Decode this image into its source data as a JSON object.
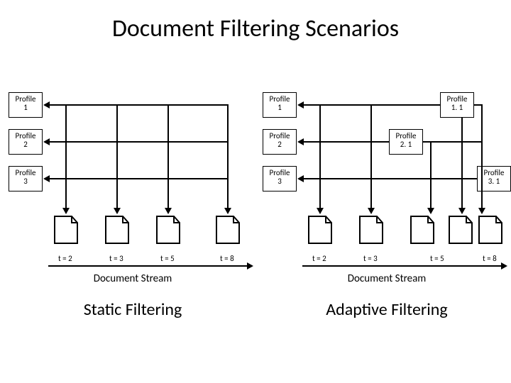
{
  "title": "Document Filtering Scenarios",
  "left": {
    "profiles": [
      "Profile\n1",
      "Profile\n2",
      "Profile\n3"
    ],
    "times": [
      "t = 2",
      "t = 3",
      "t = 5",
      "t = 8"
    ],
    "stream": "Document Stream",
    "name": "Static Filtering"
  },
  "right": {
    "profiles": [
      "Profile\n1",
      "Profile\n2",
      "Profile\n3"
    ],
    "updates": [
      "Profile\n1. 1",
      "Profile\n2. 1",
      "Profile\n3. 1"
    ],
    "times": [
      "t = 2",
      "t = 3",
      "t = 5",
      "t = 8"
    ],
    "stream": "Document Stream",
    "name": "Adaptive Filtering"
  }
}
